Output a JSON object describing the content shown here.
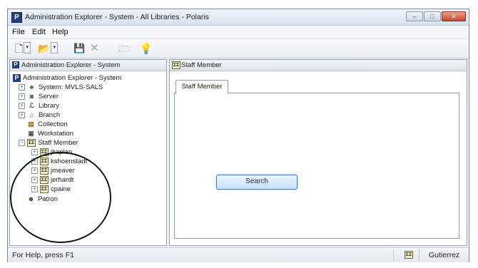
{
  "window": {
    "title": "Administration Explorer - System - All Libraries - Polaris",
    "app_icon": "P",
    "controls": {
      "minimize_glyph": "–",
      "maximize_glyph": "□",
      "close_glyph": "✕"
    }
  },
  "menu": [
    "File",
    "Edit",
    "Help"
  ],
  "toolbar": {
    "new_icon": "new-document-icon",
    "open_icon": "open-folder-icon",
    "save_icon": "save-disk-icon",
    "delete_icon": "delete-x-icon",
    "properties_icon": "properties-icon",
    "help_icon": "help-bulb-icon",
    "glyphs": {
      "new": "🗋",
      "open": "📂",
      "save": "💾",
      "delete": "✕",
      "properties": "🗁",
      "help": "💡",
      "dropdown": "▾"
    }
  },
  "left_pane": {
    "header": "Administration Explorer - System",
    "tree": {
      "root": "Administration Explorer - System",
      "system": "System: MVLS-SALS",
      "server": "Server",
      "library": "Library",
      "branch": "Branch",
      "collection": "Collection",
      "workstation": "Workstation",
      "staff_member": "Staff Member",
      "staff": [
        "jkaplan",
        "kshoenstadt",
        "jmeaver",
        "jerhardt",
        "cpaine"
      ],
      "patron": "Patron"
    },
    "glyphs": {
      "expand": "+",
      "collapse": "−",
      "root": "P",
      "staff": "ΣΣ"
    }
  },
  "right_pane": {
    "header": "Staff Member",
    "tab": "Staff Member",
    "search_button": "Search"
  },
  "status": {
    "help_text": "For Help, press F1",
    "user": "Gutierrez"
  }
}
